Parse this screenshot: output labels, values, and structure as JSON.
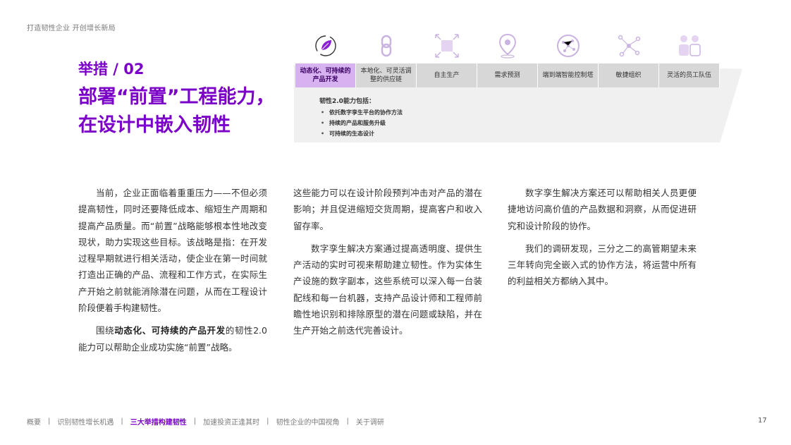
{
  "header": {
    "running_title": "打造韧性企业  开创增长新局"
  },
  "title": {
    "section_label": "举措 / 02",
    "line1": "部署“前置”工程能力，",
    "line2": "在设计中嵌入韧性"
  },
  "graphic": {
    "icons": [
      "leaf-cycle-icon",
      "chain-link-icon",
      "frame-expand-icon",
      "location-pin-icon",
      "globe-network-icon",
      "network-nodes-icon",
      "people-icon"
    ],
    "tabs": [
      {
        "label": "动态化、可持续的产品开发",
        "active": true
      },
      {
        "label": "本地化、可灵活调整的供应链",
        "active": false
      },
      {
        "label": "自主生产",
        "active": false
      },
      {
        "label": "需求预测",
        "active": false
      },
      {
        "label": "端到端智能控制塔",
        "active": false
      },
      {
        "label": "敏捷组织",
        "active": false
      },
      {
        "label": "灵活的员工队伍",
        "active": false
      }
    ],
    "capabilities_title": "韧性2.0能力包括：",
    "capabilities": [
      "依托数字孪生平台的协作方法",
      "持续的产品和服务升级",
      "可持续的生态设计"
    ],
    "colors": {
      "accent": "#7b00c8",
      "active_tab": "#d7b2f0",
      "tab": "#d7d7d7",
      "band": "#f0f0f0"
    }
  },
  "body": {
    "col1_p1": "当前，企业正面临着重重压力——不但必须提高韧性，同时还要降低成本、缩短生产周期和提高产品质量。而“前置”战略能够根本性地改变现状，助力实现这些目标。该战略是指：在开发过程早期就进行相关活动，使企业在第一时间就打造出正确的产品、流程和工作方式，在实际生产开始之前就能消除潜在问题，从而在工程设计阶段便着手构建韧性。",
    "col1_p2_before": "围绕",
    "col1_p2_bold": "动态化、可持续的产品开发",
    "col1_p2_after": "的韧性2.0能力可以帮助企业成功实施“前置”战略。",
    "col2_p1": "这些能力可以在设计阶段预判冲击对产品的潜在影响；并且促进缩短交货周期，提高客户和收入留存率。",
    "col2_p2": "数字孪生解决方案通过提高透明度、提供生产活动的实时可视来帮助建立韧性。作为实体生产设施的数字副本，这些系统可以深入每一台装配线和每一台机器，支持产品设计师和工程师前瞻性地识别和排除原型的潜在问题或缺陷，并在生产开始之前迭代完善设计。",
    "col3_p1": "数字孪生解决方案还可以帮助相关人员更便捷地访问高价值的产品数据和洞察，从而促进研究和设计阶段的协作。",
    "col3_p2": "我们的调研发现，三分之二的高管期望未来三年转向完全嵌入式的协作方法，将运营中所有的利益相关方都纳入其中。"
  },
  "footer": {
    "nav": [
      {
        "label": "概要",
        "active": false
      },
      {
        "label": "识别韧性增长机遇",
        "active": false
      },
      {
        "label": "三大举措构建韧性",
        "active": true
      },
      {
        "label": "加速投资正逢其时",
        "active": false
      },
      {
        "label": "韧性企业的中国视角",
        "active": false
      },
      {
        "label": "关于调研",
        "active": false
      }
    ],
    "separator": "|",
    "page_number": "17"
  }
}
